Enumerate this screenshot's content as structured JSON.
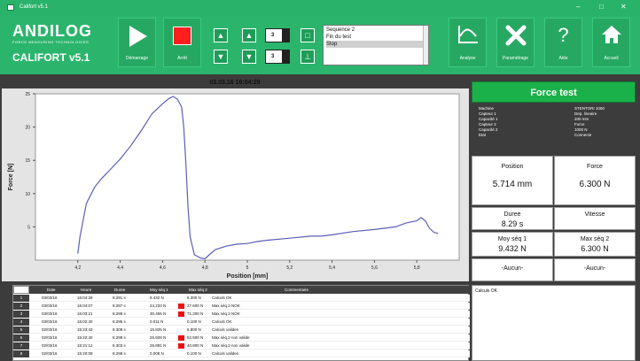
{
  "window": {
    "title": "Califort v5.1",
    "min": "–",
    "max": "□",
    "close": "✕"
  },
  "logo": {
    "brand": "ANDILOG",
    "tagline": "FORCE MEASURING TECHNOLOGIES",
    "product": "CALIFORT v5.1"
  },
  "toolbar": {
    "start_label": "Démarrage",
    "stop_label": "Arrêt",
    "counter1": "3",
    "counter2": "3",
    "sequences": [
      "Sequence 2",
      "Fin du test",
      "Stop"
    ],
    "selected_sequence": "Stop",
    "analyse_label": "Analyse",
    "settings_label": "Paramétrage",
    "help_label": "Aide",
    "home_label": "Accueil",
    "help_glyph": "?"
  },
  "chart_header": {
    "datetime": "03.03.16 16:04:29"
  },
  "chart_data": {
    "type": "line",
    "xlabel": "Position [mm]",
    "ylabel": "Force [N]",
    "xlim": [
      4.0,
      6.0
    ],
    "ylim": [
      0,
      25
    ],
    "xticks": [
      "4,2",
      "4,4",
      "4,6",
      "4,8",
      "5",
      "5,2",
      "5,4",
      "5,6",
      "5,8"
    ],
    "yticks": [
      "25",
      "20",
      "15",
      "10",
      "5"
    ],
    "grid": false,
    "series": [
      {
        "x": [
          4.2,
          4.21,
          4.24,
          4.28,
          4.31,
          4.35,
          4.4,
          4.45,
          4.5,
          4.55,
          4.6,
          4.63,
          4.65,
          4.67,
          4.69,
          4.7,
          4.71,
          4.72,
          4.73,
          4.75,
          4.78,
          4.8,
          4.82,
          4.85,
          4.9,
          4.95,
          5.0,
          5.05,
          5.1,
          5.2,
          5.3,
          5.35,
          5.4,
          5.5,
          5.6,
          5.7,
          5.75,
          5.8,
          5.82,
          5.84,
          5.86,
          5.88,
          5.9
        ],
        "y": [
          1.0,
          3.5,
          8.5,
          11.0,
          12.2,
          13.5,
          15.2,
          17.2,
          19.5,
          22.0,
          23.5,
          24.3,
          24.6,
          24.2,
          23.0,
          20.0,
          14.5,
          8.0,
          3.5,
          0.8,
          0.3,
          0.2,
          0.8,
          1.6,
          2.1,
          2.4,
          2.5,
          2.8,
          3.0,
          3.3,
          3.6,
          3.6,
          3.8,
          4.3,
          4.6,
          5.0,
          5.6,
          5.9,
          6.4,
          5.9,
          4.8,
          4.2,
          4.0
        ],
        "color": "#5b5fb5"
      }
    ]
  },
  "result": {
    "header": "Force test",
    "info": [
      [
        "Machine",
        "STENTORI 1000"
      ],
      [
        "Capteur 1",
        "Dep. lineaire"
      ],
      [
        "Capacité 1",
        "200 mm"
      ],
      [
        "Capteur 2",
        "Force"
      ],
      [
        "Capacité 2",
        "1000 N"
      ],
      [
        "Etat",
        "Connecte"
      ]
    ],
    "position_label": "Position",
    "position_value": "5.714 mm",
    "force_label": "Force",
    "force_value": "6.300 N",
    "duree_label": "Duree",
    "duree_value": "8.29 s",
    "vitesse_label": "Vitesse",
    "vitesse_value": "",
    "moy1_label": "Moy séq 1",
    "moy1_value": "9.432 N",
    "max2_label": "Max séq 2",
    "max2_value": "6.300 N",
    "aucun1": "-Aucun-",
    "aucun2": "-Aucun-"
  },
  "table": {
    "columns": [
      "Date",
      "Heure",
      "Duree",
      "Moy séq 1",
      "Max séq 2",
      "Commentaire"
    ],
    "rows": [
      {
        "n": "1",
        "date": "03/03/16",
        "heure": "16:04:29",
        "duree": "8.291 s",
        "moy": "9.432 N",
        "max": "6.300 N",
        "comment": "Calculs OK",
        "flag": false
      },
      {
        "n": "2",
        "date": "03/03/16",
        "heure": "16:04:07",
        "duree": "8.287 s",
        "moy": "24.233 N",
        "max": "27.600 N",
        "comment": "Max séq.2 NOK",
        "flag": true
      },
      {
        "n": "3",
        "date": "03/03/16",
        "heure": "16:03:21",
        "duree": "8.298 s",
        "moy": "30.455 N",
        "max": "71.200 N",
        "comment": "Max séq.2 NOK",
        "flag": true
      },
      {
        "n": "4",
        "date": "03/03/16",
        "heure": "16:02:40",
        "duree": "8.295 s",
        "moy": "0.011 N",
        "max": "0.100 N",
        "comment": "Calculs OK",
        "flag": false
      },
      {
        "n": "5",
        "date": "02/03/16",
        "heure": "15:23:43",
        "duree": "8.308 s",
        "moy": "15.825 N",
        "max": "6.800 N",
        "comment": "Calculs valides",
        "flag": false
      },
      {
        "n": "6",
        "date": "02/03/16",
        "heure": "15:22:40",
        "duree": "8.298 s",
        "moy": "26.928 N",
        "max": "52.500 N",
        "comment": "Max séq.2 non valide",
        "flag": true
      },
      {
        "n": "7",
        "date": "02/03/16",
        "heure": "15:21:12",
        "duree": "8.303 s",
        "moy": "26.881 N",
        "max": "40.800 N",
        "comment": "Max séq.2 non valide",
        "flag": true
      },
      {
        "n": "8",
        "date": "02/03/16",
        "heure": "15:20:08",
        "duree": "8.298 s",
        "moy": "0.008 N",
        "max": "0.100 N",
        "comment": "Calculs valides",
        "flag": false
      }
    ]
  },
  "message": "Calcuis OK"
}
